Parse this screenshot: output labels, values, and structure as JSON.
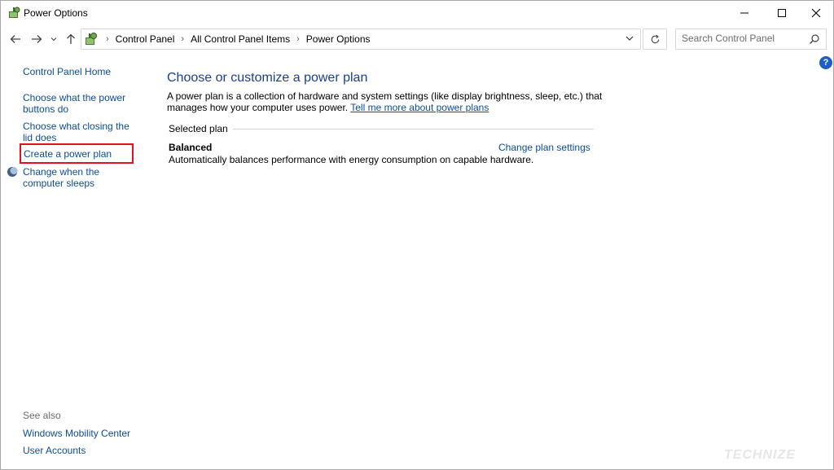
{
  "window": {
    "title": "Power Options",
    "controls": {
      "minimize_icon": "minimize-icon",
      "maximize_icon": "maximize-icon",
      "close_icon": "close-icon"
    }
  },
  "nav": {
    "back_icon": "arrow-left-icon",
    "forward_icon": "arrow-right-icon",
    "recent_icon": "chevron-down-icon",
    "up_icon": "arrow-up-icon"
  },
  "address": {
    "icon": "control-panel-icon",
    "breadcrumbs": [
      "Control Panel",
      "All Control Panel Items",
      "Power Options"
    ],
    "dropdown_icon": "chevron-down-icon",
    "refresh_icon": "refresh-icon"
  },
  "search": {
    "placeholder": "Search Control Panel",
    "value": "",
    "icon": "search-icon"
  },
  "help": {
    "label": "?"
  },
  "sidebar": {
    "home": "Control Panel Home",
    "items": [
      {
        "label": "Choose what the power buttons do"
      },
      {
        "label": "Choose what closing the lid does"
      },
      {
        "label": "Create a power plan",
        "highlighted": true
      },
      {
        "label": "Change when the computer sleeps",
        "icon": "moon-icon"
      }
    ],
    "see_also": {
      "heading": "See also",
      "links": [
        "Windows Mobility Center",
        "User Accounts"
      ]
    }
  },
  "main": {
    "title": "Choose or customize a power plan",
    "description": "A power plan is a collection of hardware and system settings (like display brightness, sleep, etc.) that manages how your computer uses power.",
    "learn_more": "Tell me more about power plans",
    "section_label": "Selected plan",
    "plan": {
      "name": "Balanced",
      "change_link": "Change plan settings",
      "description": "Automatically balances performance with energy consumption on capable hardware."
    }
  },
  "watermark": "TECHNIZE",
  "colors": {
    "link": "#0b4d9a",
    "title": "#1b3f8f",
    "highlight": "#e0121e",
    "help": "#1e5fc4"
  }
}
